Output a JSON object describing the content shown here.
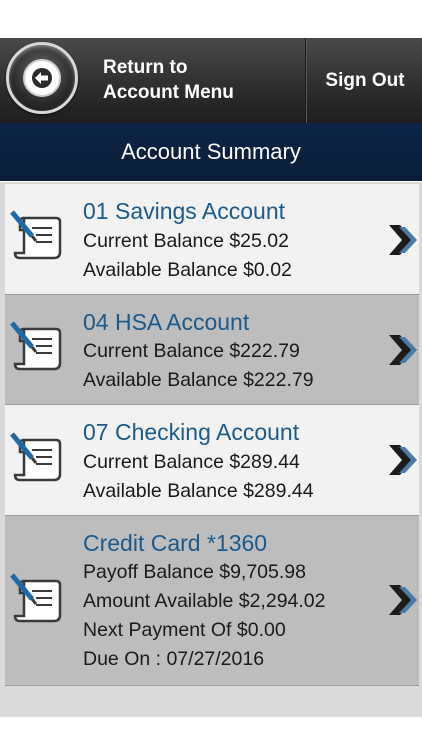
{
  "header": {
    "return_line1": "Return to",
    "return_line2": "Account Menu",
    "sign_out": "Sign Out"
  },
  "title": "Account Summary",
  "accounts": [
    {
      "name": "01 Savings Account",
      "lines": [
        "Current Balance $25.02",
        "Available Balance $0.02"
      ]
    },
    {
      "name": "04 HSA Account",
      "lines": [
        "Current Balance $222.79",
        "Available Balance $222.79"
      ]
    },
    {
      "name": "07 Checking Account",
      "lines": [
        "Current Balance $289.44",
        "Available Balance $289.44"
      ]
    },
    {
      "name": "Credit Card *1360",
      "lines": [
        "Payoff Balance $9,705.98",
        "Amount Available $2,294.02",
        "Next Payment Of $0.00",
        "Due On : 07/27/2016"
      ]
    }
  ],
  "icons": {
    "back": "back-arrow-icon",
    "account": "document-pencil-icon",
    "row_action": "double-chevron-right-icon"
  },
  "colors": {
    "account_name": "#1a5a8c",
    "title_bar": "#0d2446",
    "header": "#2f2f2f"
  }
}
